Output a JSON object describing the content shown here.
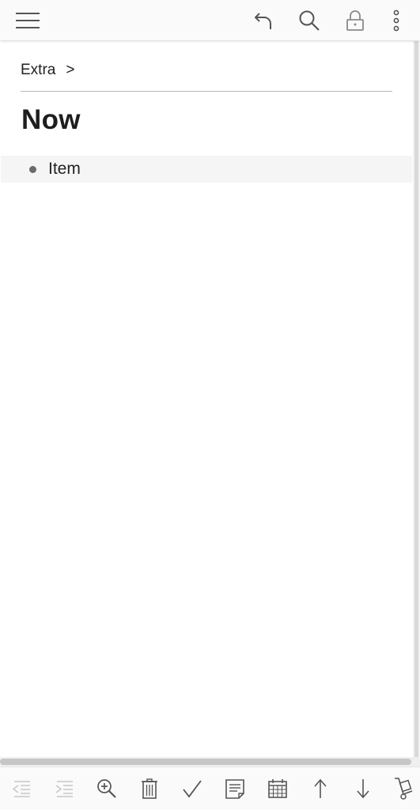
{
  "toolbar": {
    "icons": [
      "menu-icon",
      "undo-icon",
      "search-icon",
      "lock-icon",
      "more-vert-icon"
    ]
  },
  "breadcrumb": {
    "item": "Extra",
    "separator": ">"
  },
  "page": {
    "title": "Now"
  },
  "list": {
    "items": [
      {
        "label": "Item"
      }
    ]
  },
  "bottom_toolbar": {
    "icons": [
      "outdent-icon",
      "indent-icon",
      "zoom-in-icon",
      "trash-icon",
      "check-icon",
      "note-icon",
      "calendar-icon",
      "move-up-icon",
      "move-down-icon",
      "hand-truck-icon"
    ],
    "disabled": [
      "outdent-icon",
      "indent-icon"
    ]
  },
  "colors": {
    "icon": "#555555",
    "icon_disabled": "#c8c8c8",
    "bar_background": "#fafafa",
    "row_highlight": "#f5f5f5"
  }
}
